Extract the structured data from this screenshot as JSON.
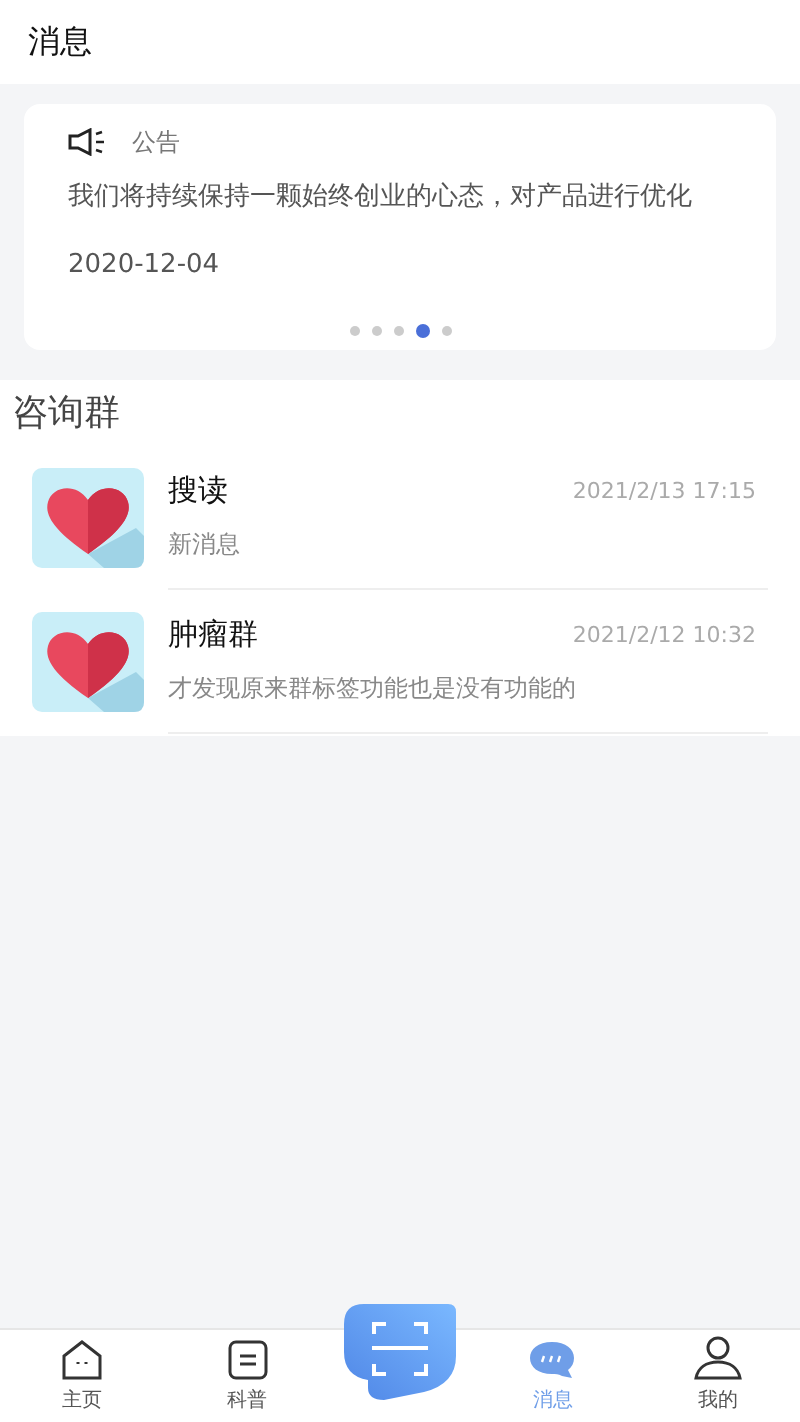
{
  "header": {
    "title": "消息"
  },
  "notice": {
    "label": "公告",
    "text": "我们将持续保持一颗始终创业的心态，对产品进行优化",
    "date": "2020-12-04",
    "dots": [
      {
        "selected": false
      },
      {
        "selected": false
      },
      {
        "selected": false
      },
      {
        "selected": true
      },
      {
        "selected": false
      }
    ]
  },
  "groups": {
    "title": "咨询群",
    "items": [
      {
        "name": "搜读",
        "time": "2021/2/13 17:15",
        "message": "新消息"
      },
      {
        "name": "肿瘤群",
        "time": "2021/2/12 10:32",
        "message": "才发现原来群标签功能也是没有功能的"
      }
    ]
  },
  "tab_bar": [
    {
      "kind": "home",
      "label": "主页",
      "selected": false
    },
    {
      "kind": "science",
      "label": "科普",
      "selected": false
    },
    {
      "kind": "scan"
    },
    {
      "kind": "messages",
      "label": "消息",
      "selected": true
    },
    {
      "kind": "profile",
      "label": "我的",
      "selected": false
    }
  ]
}
